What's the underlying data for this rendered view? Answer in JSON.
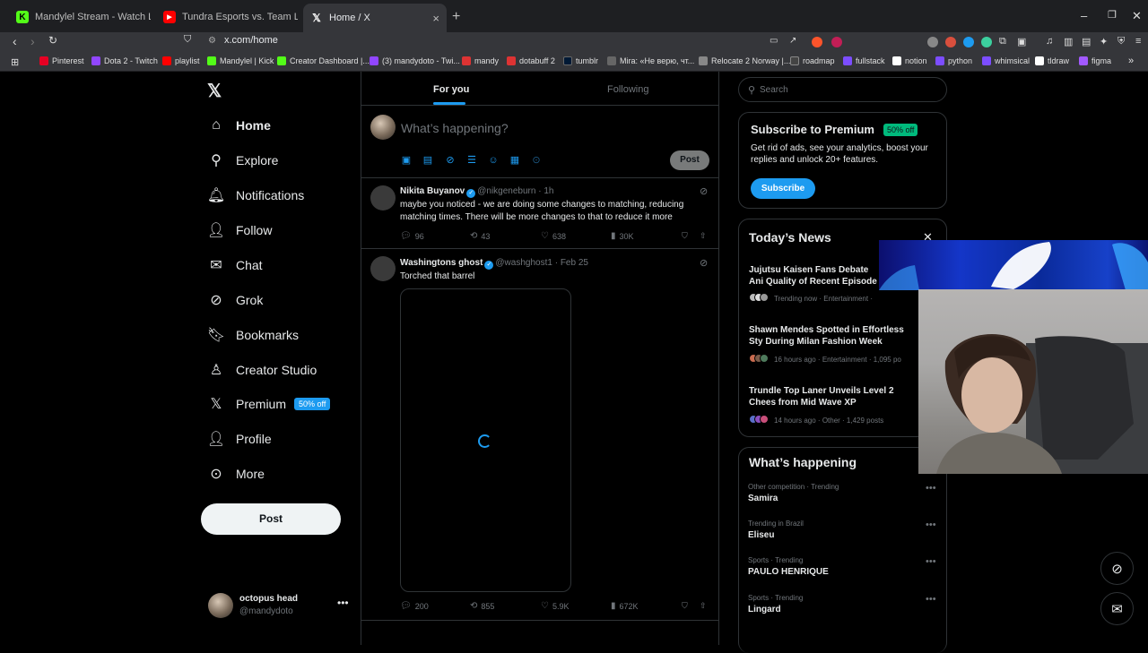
{
  "browser": {
    "tabs": [
      {
        "title": "Mandylel Stream - Watch Live on Kick",
        "icon": "kick-logo-icon",
        "color": "#53fc18"
      },
      {
        "title": "Tundra Esports vs. Team Liquid - Dream",
        "icon": "youtube-logo-icon",
        "color": "#ff0000"
      },
      {
        "title": "Home / X",
        "icon": "x-logo-icon",
        "color": "#ffffff"
      }
    ],
    "url": "x.com/home",
    "bookmarks": [
      {
        "label": "Pinterest",
        "color": "#e60023"
      },
      {
        "label": "Dota 2 - Twitch",
        "color": "#9146ff"
      },
      {
        "label": "playlist",
        "color": "#ff0000"
      },
      {
        "label": "Mandylel | Kick",
        "color": "#53fc18"
      },
      {
        "label": "Creator Dashboard |...",
        "color": "#53fc18"
      },
      {
        "label": "(3) mandydoto - Twi...",
        "color": "#9146ff"
      },
      {
        "label": "mandy",
        "color": "#d33"
      },
      {
        "label": "dotabuff 2",
        "color": "#d33"
      },
      {
        "label": "tumblr",
        "color": "#001935"
      },
      {
        "label": "Mira: «Не верю, чт...",
        "color": "#666"
      },
      {
        "label": "Relocate 2 Norway |...",
        "color": "#888"
      },
      {
        "label": "roadmap",
        "color": "#444"
      },
      {
        "label": "fullstack",
        "color": "#7c4dff"
      },
      {
        "label": "notion",
        "color": "#fff"
      },
      {
        "label": "python",
        "color": "#7c4dff"
      },
      {
        "label": "whimsical",
        "color": "#7c4dff"
      },
      {
        "label": "tldraw",
        "color": "#fff"
      },
      {
        "label": "figma",
        "color": "#a259ff"
      }
    ]
  },
  "sidebar": {
    "items": [
      {
        "label": "Home",
        "icon": "home-icon"
      },
      {
        "label": "Explore",
        "icon": "search-icon"
      },
      {
        "label": "Notifications",
        "icon": "bell-icon"
      },
      {
        "label": "Follow",
        "icon": "add-user-icon"
      },
      {
        "label": "Chat",
        "icon": "mail-icon"
      },
      {
        "label": "Grok",
        "icon": "grok-icon"
      },
      {
        "label": "Bookmarks",
        "icon": "bookmark-icon"
      },
      {
        "label": "Creator Studio",
        "icon": "creator-studio-icon"
      },
      {
        "label": "Premium",
        "icon": "x-logo-icon"
      },
      {
        "label": "Profile",
        "icon": "person-icon"
      },
      {
        "label": "More",
        "icon": "more-circle-icon"
      }
    ],
    "premium_badge": "50% off",
    "post_label": "Post",
    "account": {
      "name": "octopus head",
      "handle": "@mandydoto"
    }
  },
  "feed": {
    "tabs": [
      "For you",
      "Following"
    ],
    "compose_placeholder": "What’s happening?",
    "compose_post_label": "Post",
    "tweets": [
      {
        "name": "Nikita Buyanov",
        "handle": "@nikgeneburn",
        "time": "1h",
        "text": "maybe you noticed - we are doing some changes to matching, reducing matching times. There will be more changes to that to reduce it more",
        "replies": "96",
        "reposts": "43",
        "likes": "638",
        "views": "30K"
      },
      {
        "name": "Washingtons ghost",
        "handle": "@washghost1",
        "time": "Feb 25",
        "text": "Torched that barrel",
        "replies": "200",
        "reposts": "855",
        "likes": "5.9K",
        "views": "672K"
      }
    ]
  },
  "right": {
    "search_placeholder": "Search",
    "premium": {
      "title": "Subscribe to Premium",
      "badge": "50% off",
      "text": "Get rid of ads, see your analytics, boost your replies and unlock 20+ features.",
      "button": "Subscribe"
    },
    "news": {
      "title": "Today’s News",
      "items": [
        {
          "title": "Jujutsu Kaisen Fans Debate Ani Quality of Recent Episode Feat",
          "meta": "Trending now · Entertainment ·"
        },
        {
          "title": "Shawn Mendes Spotted in Effortless Sty During Milan Fashion Week",
          "meta": "16 hours ago · Entertainment · 1,095 po"
        },
        {
          "title": "Trundle Top Laner Unveils Level 2 Chees from Mid Wave XP",
          "meta": "14 hours ago · Other · 1,429 posts"
        }
      ]
    },
    "happening": {
      "title": "What’s happening",
      "trends": [
        {
          "meta": "Other competition · Trending",
          "name": "Samira"
        },
        {
          "meta": "Trending in Brazil",
          "name": "Eliseu"
        },
        {
          "meta": "Sports · Trending",
          "name": "PAULO HENRIQUE"
        },
        {
          "meta": "Sports · Trending",
          "name": "Lingard"
        }
      ]
    }
  },
  "colors": {
    "accent": "#1d9bf0",
    "premium_badge": "#00ba7c",
    "border": "#2f3336"
  }
}
